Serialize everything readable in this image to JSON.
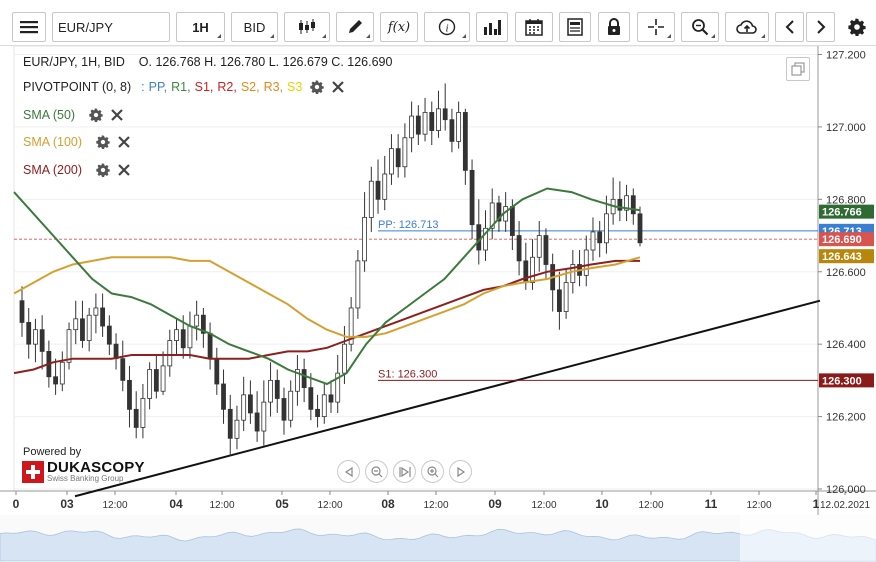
{
  "toolbar": {
    "symbol": "EUR/JPY",
    "timeframe": "1H",
    "side": "BID",
    "fx_label": "f(x)"
  },
  "legend": {
    "ohlc": "EUR/JPY, 1H, BID    O. 126.768 H. 126.780 L. 126.679 C. 126.690",
    "pivot_title": "PIVOTPOINT (0, 8)",
    "pivot_sep": ":",
    "pivot_items": [
      {
        "label": "PP",
        "color": "#3a7fd0"
      },
      {
        "label": "R1",
        "color": "#3c8a3c"
      },
      {
        "label": "S1",
        "color": "#cc2020"
      },
      {
        "label": "R2",
        "color": "#cc2020"
      },
      {
        "label": "S2",
        "color": "#e08a1a"
      },
      {
        "label": "R3",
        "color": "#e08a1a"
      },
      {
        "label": "S3",
        "color": "#e8d200"
      }
    ],
    "sma": [
      {
        "label": "SMA (50)",
        "color": "#3c7a3c"
      },
      {
        "label": "SMA (100)",
        "color": "#d4a030"
      },
      {
        "label": "SMA (200)",
        "color": "#8c2020"
      }
    ]
  },
  "branding": {
    "powered": "Powered by",
    "name": "DUKASCOPY",
    "tagline": "Swiss Banking Group"
  },
  "chart_data": {
    "type": "candlestick",
    "y_range": [
      126.0,
      127.2
    ],
    "y_ticks": [
      "127.200",
      "127.000",
      "126.800",
      "126.600",
      "126.400",
      "126.200",
      "126.000"
    ],
    "x_tick_labels": [
      "0",
      "03",
      "12:00",
      "04",
      "12:00",
      "05",
      "12:00",
      "08",
      "12:00",
      "09",
      "12:00",
      "10",
      "12:00",
      "11",
      "12:00",
      "1",
      "12.02.2021"
    ],
    "price_tags": [
      {
        "value": 126.766,
        "label": "126.766",
        "color": "#2e6b32"
      },
      {
        "value": 126.713,
        "label": "126.713",
        "color": "#3a7fd0"
      },
      {
        "value": 126.69,
        "label": "126.690",
        "color": "#d9534f"
      },
      {
        "value": 126.643,
        "label": "126.643",
        "color": "#b8860b"
      },
      {
        "value": 126.3,
        "label": "126.300",
        "color": "#8b1a1a"
      }
    ],
    "pivot_lines": [
      {
        "label": "PP: 126.713",
        "value": 126.713,
        "color": "#3a7fd0"
      },
      {
        "label": "S1: 126.300",
        "value": 126.3,
        "color": "#8b1a1a"
      }
    ],
    "current_price": 126.69,
    "sma50": [
      [
        0,
        126.82
      ],
      [
        20,
        126.76
      ],
      [
        40,
        126.7
      ],
      [
        60,
        126.64
      ],
      [
        80,
        126.58
      ],
      [
        100,
        126.54
      ],
      [
        120,
        126.53
      ],
      [
        140,
        126.51
      ],
      [
        160,
        126.48
      ],
      [
        180,
        126.45
      ],
      [
        200,
        126.43
      ],
      [
        220,
        126.4
      ],
      [
        240,
        126.38
      ],
      [
        260,
        126.36
      ],
      [
        280,
        126.33
      ],
      [
        300,
        126.31
      ],
      [
        320,
        126.29
      ],
      [
        340,
        126.32
      ],
      [
        360,
        126.4
      ],
      [
        380,
        126.46
      ],
      [
        400,
        126.5
      ],
      [
        420,
        126.54
      ],
      [
        440,
        126.58
      ],
      [
        460,
        126.64
      ],
      [
        480,
        126.7
      ],
      [
        500,
        126.76
      ],
      [
        520,
        126.8
      ],
      [
        545,
        126.83
      ],
      [
        570,
        126.82
      ],
      [
        590,
        126.8
      ],
      [
        615,
        126.78
      ],
      [
        640,
        126.77
      ]
    ],
    "sma100": [
      [
        0,
        126.54
      ],
      [
        20,
        126.57
      ],
      [
        40,
        126.6
      ],
      [
        60,
        126.62
      ],
      [
        80,
        126.63
      ],
      [
        100,
        126.64
      ],
      [
        120,
        126.64
      ],
      [
        140,
        126.64
      ],
      [
        160,
        126.64
      ],
      [
        180,
        126.63
      ],
      [
        200,
        126.63
      ],
      [
        220,
        126.6
      ],
      [
        240,
        126.57
      ],
      [
        260,
        126.54
      ],
      [
        280,
        126.51
      ],
      [
        300,
        126.47
      ],
      [
        320,
        126.44
      ],
      [
        340,
        126.42
      ],
      [
        360,
        126.42
      ],
      [
        380,
        126.43
      ],
      [
        400,
        126.45
      ],
      [
        420,
        126.47
      ],
      [
        440,
        126.49
      ],
      [
        460,
        126.51
      ],
      [
        480,
        126.54
      ],
      [
        500,
        126.56
      ],
      [
        520,
        126.57
      ],
      [
        545,
        126.58
      ],
      [
        570,
        126.6
      ],
      [
        590,
        126.61
      ],
      [
        615,
        126.62
      ],
      [
        640,
        126.64
      ]
    ],
    "sma200": [
      [
        0,
        126.32
      ],
      [
        20,
        126.33
      ],
      [
        40,
        126.35
      ],
      [
        60,
        126.36
      ],
      [
        80,
        126.36
      ],
      [
        100,
        126.36
      ],
      [
        120,
        126.37
      ],
      [
        140,
        126.37
      ],
      [
        160,
        126.37
      ],
      [
        180,
        126.37
      ],
      [
        200,
        126.36
      ],
      [
        220,
        126.36
      ],
      [
        240,
        126.36
      ],
      [
        260,
        126.37
      ],
      [
        280,
        126.38
      ],
      [
        300,
        126.38
      ],
      [
        320,
        126.39
      ],
      [
        340,
        126.41
      ],
      [
        360,
        126.43
      ],
      [
        380,
        126.45
      ],
      [
        400,
        126.47
      ],
      [
        420,
        126.49
      ],
      [
        440,
        126.51
      ],
      [
        460,
        126.53
      ],
      [
        480,
        126.55
      ],
      [
        500,
        126.56
      ],
      [
        520,
        126.58
      ],
      [
        545,
        126.6
      ],
      [
        570,
        126.61
      ],
      [
        590,
        126.62
      ],
      [
        615,
        126.63
      ],
      [
        640,
        126.63
      ]
    ],
    "trendline": [
      [
        75,
        125.98
      ],
      [
        820,
        126.52
      ]
    ],
    "candles": [
      [
        126.52,
        126.46,
        126.56,
        126.42
      ],
      [
        126.46,
        126.4,
        126.5,
        126.36
      ],
      [
        126.4,
        126.44,
        126.47,
        126.35
      ],
      [
        126.44,
        126.38,
        126.48,
        126.33
      ],
      [
        126.38,
        126.31,
        126.41,
        126.28
      ],
      [
        126.31,
        126.29,
        126.36,
        126.26
      ],
      [
        126.29,
        126.35,
        126.38,
        126.27
      ],
      [
        126.35,
        126.44,
        126.46,
        126.33
      ],
      [
        126.44,
        126.47,
        126.52,
        126.4
      ],
      [
        126.47,
        126.41,
        126.52,
        126.39
      ],
      [
        126.41,
        126.48,
        126.5,
        126.38
      ],
      [
        126.48,
        126.5,
        126.54,
        126.43
      ],
      [
        126.5,
        126.45,
        126.54,
        126.42
      ],
      [
        126.45,
        126.4,
        126.48,
        126.37
      ],
      [
        126.4,
        126.36,
        126.43,
        126.33
      ],
      [
        126.36,
        126.3,
        126.41,
        126.27
      ],
      [
        126.3,
        126.22,
        126.34,
        126.17
      ],
      [
        126.22,
        126.17,
        126.27,
        126.14
      ],
      [
        126.17,
        126.25,
        126.29,
        126.14
      ],
      [
        126.25,
        126.33,
        126.35,
        126.22
      ],
      [
        126.33,
        126.27,
        126.37,
        126.25
      ],
      [
        126.27,
        126.34,
        126.38,
        126.26
      ],
      [
        126.34,
        126.41,
        126.44,
        126.31
      ],
      [
        126.41,
        126.44,
        126.47,
        126.37
      ],
      [
        126.44,
        126.39,
        126.48,
        126.36
      ],
      [
        126.39,
        126.45,
        126.49,
        126.36
      ],
      [
        126.45,
        126.48,
        126.52,
        126.41
      ],
      [
        126.48,
        126.43,
        126.5,
        126.39
      ],
      [
        126.43,
        126.36,
        126.46,
        126.33
      ],
      [
        126.36,
        126.29,
        126.39,
        126.26
      ],
      [
        126.29,
        126.22,
        126.33,
        126.18
      ],
      [
        126.22,
        126.14,
        126.26,
        126.09
      ],
      [
        126.14,
        126.19,
        126.23,
        126.11
      ],
      [
        126.19,
        126.26,
        126.31,
        126.16
      ],
      [
        126.26,
        126.21,
        126.3,
        126.18
      ],
      [
        126.21,
        126.16,
        126.27,
        126.13
      ],
      [
        126.16,
        126.24,
        126.3,
        126.12
      ],
      [
        126.24,
        126.3,
        126.35,
        126.2
      ],
      [
        126.3,
        126.25,
        126.33,
        126.21
      ],
      [
        126.25,
        126.19,
        126.28,
        126.15
      ],
      [
        126.19,
        126.27,
        126.3,
        126.17
      ],
      [
        126.27,
        126.33,
        126.37,
        126.23
      ],
      [
        126.33,
        126.28,
        126.36,
        126.24
      ],
      [
        126.28,
        126.22,
        126.32,
        126.19
      ],
      [
        126.22,
        126.2,
        126.26,
        126.17
      ],
      [
        126.2,
        126.26,
        126.29,
        126.18
      ],
      [
        126.26,
        126.24,
        126.3,
        126.21
      ],
      [
        126.24,
        126.32,
        126.37,
        126.21
      ],
      [
        126.32,
        126.4,
        126.45,
        126.29
      ],
      [
        126.4,
        126.5,
        126.53,
        126.38
      ],
      [
        126.5,
        126.63,
        126.66,
        126.47
      ],
      [
        126.63,
        126.75,
        126.82,
        126.6
      ],
      [
        126.75,
        126.85,
        126.89,
        126.71
      ],
      [
        126.85,
        126.8,
        126.91,
        126.76
      ],
      [
        126.8,
        126.87,
        126.92,
        126.77
      ],
      [
        126.87,
        126.94,
        126.98,
        126.84
      ],
      [
        126.94,
        126.89,
        126.98,
        126.86
      ],
      [
        126.89,
        126.97,
        127.01,
        126.86
      ],
      [
        126.97,
        127.03,
        127.07,
        126.93
      ],
      [
        127.03,
        126.98,
        127.06,
        126.95
      ],
      [
        126.98,
        127.04,
        127.08,
        126.96
      ],
      [
        127.04,
        126.99,
        127.07,
        126.95
      ],
      [
        126.99,
        127.05,
        127.1,
        126.97
      ],
      [
        127.05,
        127.02,
        127.12,
        126.99
      ],
      [
        127.02,
        126.96,
        127.05,
        126.93
      ],
      [
        126.96,
        127.04,
        127.07,
        126.94
      ],
      [
        127.04,
        126.88,
        127.05,
        126.84
      ],
      [
        126.88,
        126.73,
        126.91,
        126.69
      ],
      [
        126.73,
        126.66,
        126.8,
        126.62
      ],
      [
        126.66,
        126.72,
        126.77,
        126.63
      ],
      [
        126.72,
        126.79,
        126.83,
        126.69
      ],
      [
        126.79,
        126.74,
        126.81,
        126.71
      ],
      [
        126.74,
        126.78,
        126.82,
        126.71
      ],
      [
        126.78,
        126.7,
        126.8,
        126.66
      ],
      [
        126.7,
        126.63,
        126.74,
        126.59
      ],
      [
        126.63,
        126.57,
        126.68,
        126.55
      ],
      [
        126.57,
        126.64,
        126.69,
        126.55
      ],
      [
        126.64,
        126.7,
        126.74,
        126.6
      ],
      [
        126.7,
        126.62,
        126.72,
        126.58
      ],
      [
        126.62,
        126.55,
        126.65,
        126.49
      ],
      [
        126.55,
        126.49,
        126.6,
        126.44
      ],
      [
        126.49,
        126.57,
        126.61,
        126.47
      ],
      [
        126.57,
        126.62,
        126.66,
        126.54
      ],
      [
        126.62,
        126.59,
        126.66,
        126.56
      ],
      [
        126.59,
        126.66,
        126.7,
        126.56
      ],
      [
        126.66,
        126.71,
        126.75,
        126.63
      ],
      [
        126.71,
        126.68,
        126.74,
        126.64
      ],
      [
        126.68,
        126.76,
        126.81,
        126.65
      ],
      [
        126.76,
        126.8,
        126.86,
        126.73
      ],
      [
        126.8,
        126.77,
        126.85,
        126.74
      ],
      [
        126.77,
        126.81,
        126.84,
        126.74
      ],
      [
        126.81,
        126.76,
        126.83,
        126.73
      ],
      [
        126.76,
        126.68,
        126.78,
        126.67
      ]
    ]
  }
}
